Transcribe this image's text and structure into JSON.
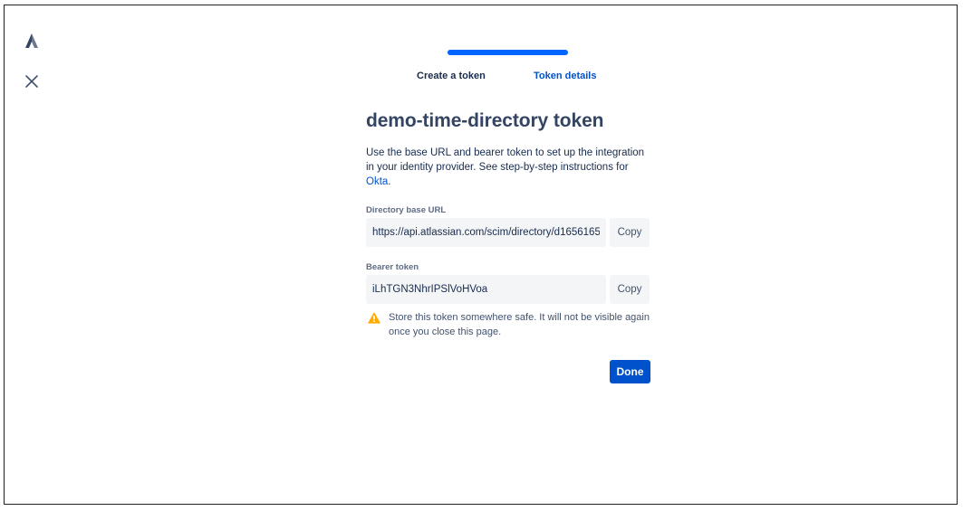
{
  "steps": [
    {
      "label": "Create a token"
    },
    {
      "label": "Token details"
    }
  ],
  "progress": 1.0,
  "title": "demo-time-directory token",
  "intro": {
    "text": "Use the base URL and bearer token to set up the integration in your identity provider. See step-by-step instructions for ",
    "link": "Okta",
    "end": "."
  },
  "directory_url": {
    "label": "Directory base URL",
    "value": "https://api.atlassian.com/scim/directory/d1656165",
    "copy_label": "Copy"
  },
  "bearer_token": {
    "label": "Bearer token",
    "value": "iLhTGN3NhrIPSlVoHVoa",
    "copy_label": "Copy"
  },
  "warning": "Store this token somewhere safe. It will not be visible again once you close this page.",
  "done_label": "Done",
  "colors": {
    "brand_blue": "#0052cc",
    "progress_blue": "#0065ff",
    "warning": "#ffab00",
    "text": "#172b4d"
  }
}
